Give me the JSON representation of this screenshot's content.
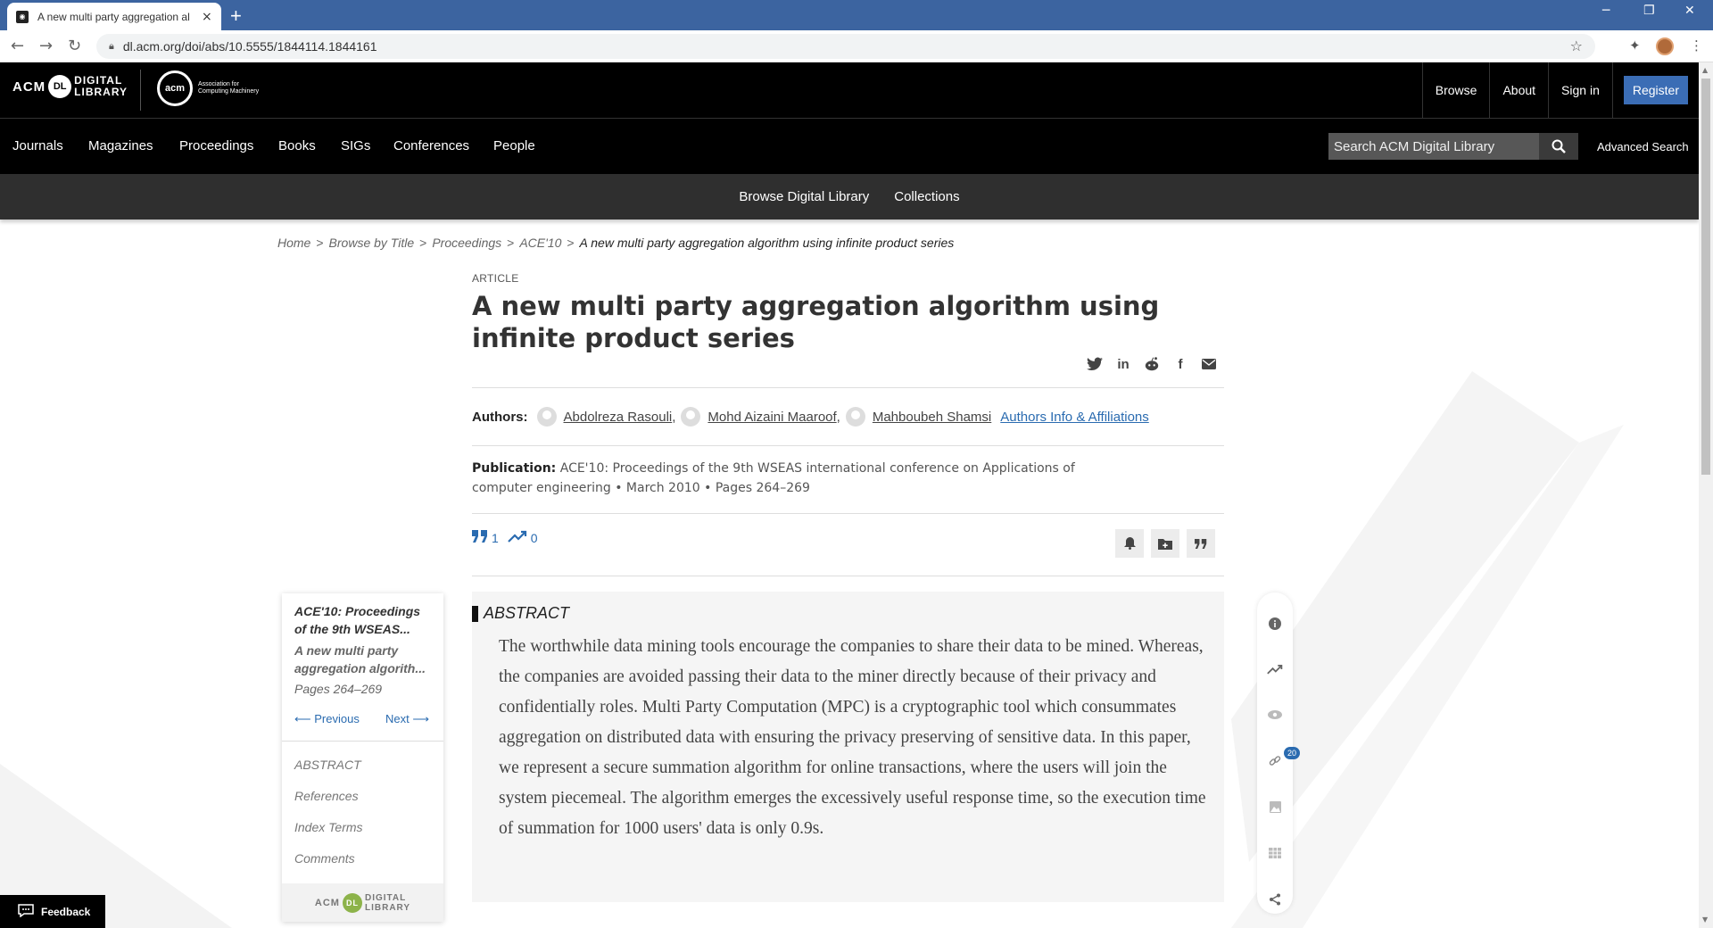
{
  "browser": {
    "tab_title": "A new multi party aggregation al",
    "tab_close": "×",
    "new_tab": "+",
    "url": "dl.acm.org/doi/abs/10.5555/1844114.1844161"
  },
  "header": {
    "logo_acm": "ACM",
    "logo_dl": "DL",
    "logo_digital": "DIGITAL",
    "logo_library": "LIBRARY",
    "assoc_logo": "acm",
    "assoc_line1": "Association for",
    "assoc_line2": "Computing Machinery",
    "links": [
      "Browse",
      "About",
      "Sign in"
    ],
    "register": "Register",
    "nav": [
      "Journals",
      "Magazines",
      "Proceedings",
      "Books",
      "SIGs",
      "Conferences",
      "People"
    ],
    "search_placeholder": "Search ACM Digital Library",
    "advanced_search": "Advanced Search",
    "subnav": [
      "Browse Digital Library",
      "Collections"
    ]
  },
  "breadcrumb": {
    "items": [
      "Home",
      "Browse by Title",
      "Proceedings",
      "ACE'10"
    ],
    "separator": ">",
    "current": "A new multi party aggregation algorithm using infinite product series"
  },
  "article": {
    "type": "ARTICLE",
    "title": "A new multi party aggregation algorithm using infinite product series",
    "authors_label": "Authors:",
    "authors": [
      "Abdolreza Rasouli",
      "Mohd Aizaini Maaroof",
      "Mahboubeh Shamsi"
    ],
    "affiliations_link": "Authors Info & Affiliations",
    "publication_label": "Publication:",
    "publication": "ACE'10: Proceedings of the 9th WSEAS international conference on Applications of computer engineering",
    "date": "March 2010",
    "pages": "Pages 264–269",
    "citations": "1",
    "downloads": "0",
    "abstract_heading": "ABSTRACT",
    "abstract": "The worthwhile data mining tools encourage the companies to share their data to be mined. Whereas, the companies are avoided passing their data to the miner directly because of their privacy and confidentially roles. Multi Party Computation (MPC) is a cryptographic tool which consummates aggregation on distributed data with ensuring the privacy preserving of sensitive data. In this paper, we represent a secure summation algorithm for online transactions, where the users will join the system piecemeal. The algorithm emerges the excessively useful response time, so the execution time of summation for 1000 users' data is only 0.9s."
  },
  "toc": {
    "proceedings": "ACE'10: Proceedings of the 9th WSEAS...",
    "article": "A new multi party aggregation algorith...",
    "pages": "Pages 264–269",
    "previous": "⟵ Previous",
    "next": "Next ⟶",
    "items": [
      "ABSTRACT",
      "References",
      "Index Terms",
      "Comments"
    ],
    "footer_acm": "ACM",
    "footer_dl": "DL",
    "footer_digital": "DIGITAL",
    "footer_library": "LIBRARY"
  },
  "rail": {
    "references_badge": "20"
  },
  "feedback": "Feedback",
  "colors": {
    "tabstrip": "#3c64a0",
    "header_bg": "#000000",
    "subnav_bg": "#2f2f2f",
    "link": "#2a6bb0",
    "register_bg": "#3b6db5"
  },
  "icons": {
    "share": [
      "twitter-icon",
      "linkedin-icon",
      "reddit-icon",
      "facebook-icon",
      "email-icon"
    ],
    "actions": [
      "bell-icon",
      "folder-add-icon",
      "quote-icon"
    ],
    "rail": [
      "info-icon",
      "trending-icon",
      "eye-icon",
      "link-icon",
      "image-icon",
      "table-icon",
      "share-icon"
    ]
  }
}
